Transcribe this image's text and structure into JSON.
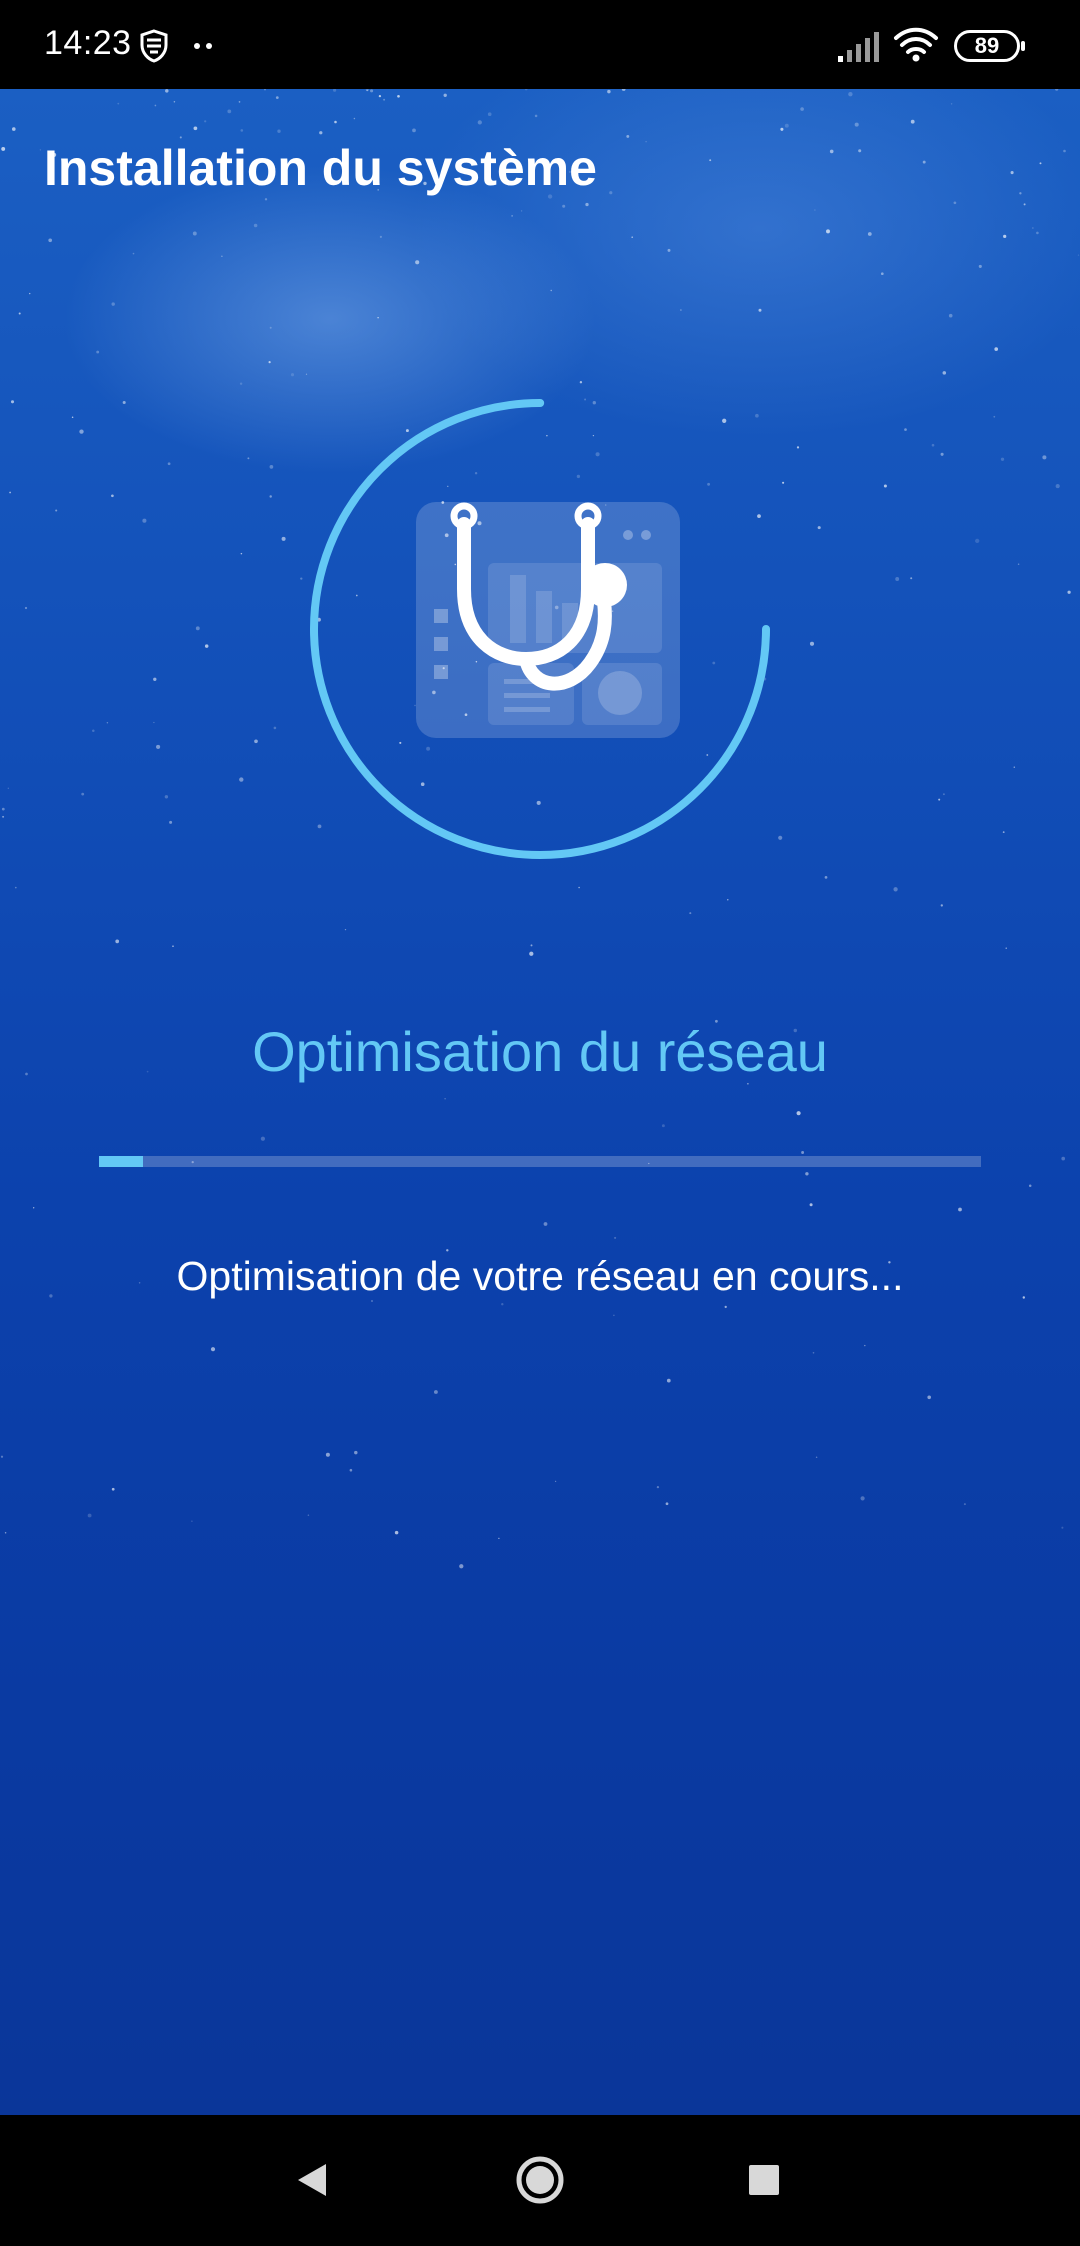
{
  "status_bar": {
    "time": "14:23",
    "battery_level": "89",
    "icons": [
      "shield-icon",
      "notification-dots-icon",
      "signal-icon",
      "wifi-icon",
      "battery-icon"
    ]
  },
  "page": {
    "title": "Installation du système",
    "step_title": "Optimisation du réseau",
    "status_message": "Optimisation de votre réseau en cours...",
    "progress_fraction": 0.05,
    "ring_progress_fraction": 0.75,
    "hero_icon": "stethoscope-dashboard-icon"
  },
  "nav_bar": {
    "buttons": [
      "back-icon",
      "home-icon",
      "recents-icon"
    ]
  },
  "colors": {
    "accent": "#63c8f5",
    "background_top": "#1b5fc3",
    "background_bottom": "#0a3699",
    "text": "#ffffff"
  }
}
